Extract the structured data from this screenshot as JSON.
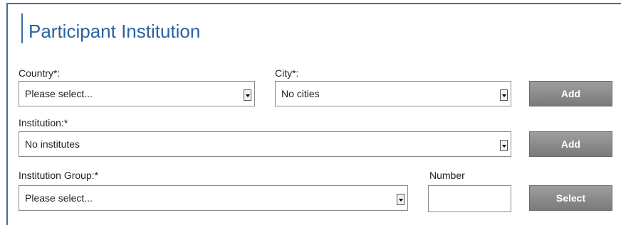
{
  "section": {
    "title": "Participant Institution"
  },
  "country": {
    "label": "Country*:",
    "value": "Please select..."
  },
  "city": {
    "label": "City*:",
    "value": "No cities"
  },
  "institution": {
    "label": "Institution:*",
    "value": "No institutes"
  },
  "institution_group": {
    "label": "Institution Group:*",
    "value": "Please select..."
  },
  "number": {
    "label": "Number",
    "value": ""
  },
  "buttons": {
    "add_city": "Add",
    "add_institution": "Add",
    "select_group": "Select"
  }
}
